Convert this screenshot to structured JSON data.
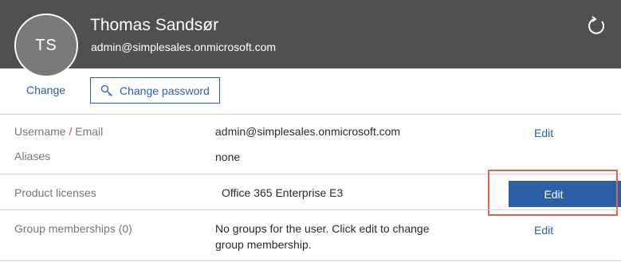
{
  "header": {
    "avatar_initials": "TS",
    "name": "Thomas Sandsør",
    "email": "admin@simplesales.onmicrosoft.com",
    "refresh_icon": "refresh-icon",
    "background_color": "#505050"
  },
  "actions": {
    "change_label": "Change",
    "change_password_label": "Change password",
    "change_password_icon": "key-icon",
    "accent_color": "#2b5faa"
  },
  "details": {
    "username_label_part1": "Username ",
    "username_label_slash": "/",
    "username_label_part2": " Email",
    "username_value": "admin@simplesales.onmicrosoft.com",
    "aliases_label": "Aliases",
    "aliases_value": "none",
    "licenses_label": "Product licenses",
    "licenses_value": "Office 365 Enterprise E3",
    "groups_label": "Group memberships (0)",
    "groups_value_line1": "No groups for the user. Click edit to change",
    "groups_value_line2": "group membership.",
    "edit_label": "Edit"
  }
}
